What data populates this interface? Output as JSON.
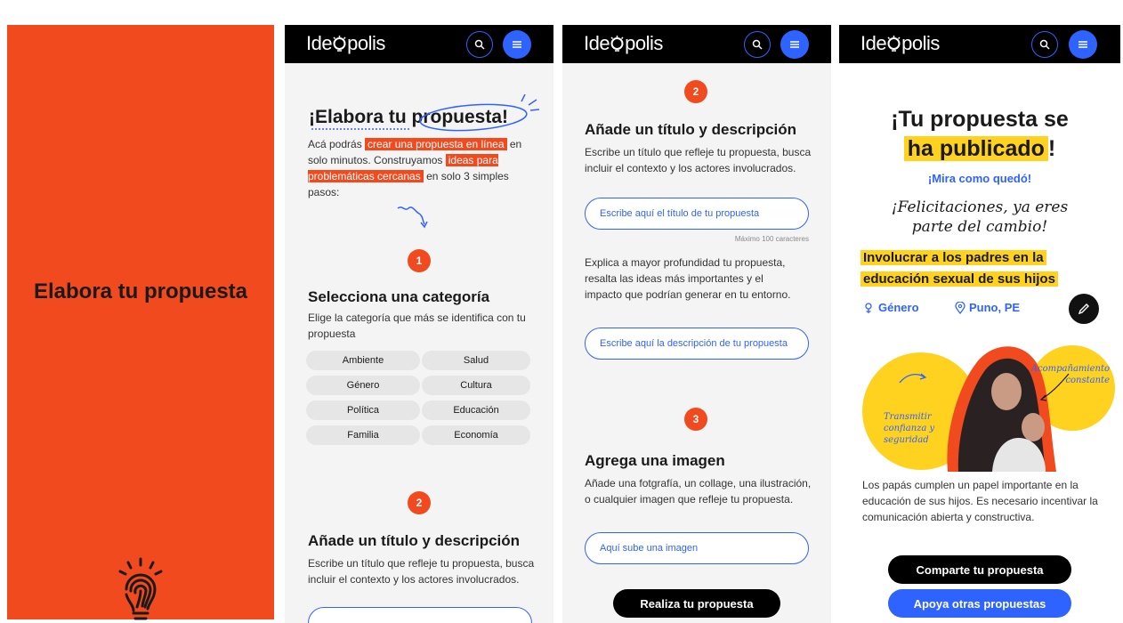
{
  "cover": {
    "title": "Elabora tu propuesta"
  },
  "app": {
    "logo": "Ide polis"
  },
  "screen1": {
    "title": "¡Elabora tu propuesta!",
    "intro": {
      "t1": "Acá podrás ",
      "h1": "crear una propuesta en línea",
      "t2": " en solo minutos. Construyamos ",
      "h2": "ideas para problemáticas cercanas",
      "t3": " en solo 3 simples pasos:"
    },
    "step1": {
      "number": "1",
      "title": "Selecciona una categoría",
      "desc": "Elige la categoría que más se identifica con tu propuesta"
    },
    "categories": [
      "Ambiente",
      "Salud",
      "Género",
      "Cultura",
      "Política",
      "Educación",
      "Familia",
      "Economía"
    ],
    "step2": {
      "number": "2",
      "title": "Añade un título y descripción",
      "desc": "Escribe un título que refleje tu propuesta, busca incluir el contexto y los actores involucrados."
    }
  },
  "screen2": {
    "step2": {
      "number": "2",
      "title": "Añade un título y descripción",
      "desc": "Escribe un título que refleje tu propuesta, busca incluir el contexto y los actores involucrados."
    },
    "title_input": {
      "placeholder": "Escribe aquí el título de tu propuesta",
      "hint": "Máximo 100 caracteres"
    },
    "desc_text": "Explica a mayor profundidad tu propuesta, resalta las ideas más importantes y el impacto que podrían generar en tu entorno.",
    "desc_input": {
      "placeholder": "Escribe aquí la descripción de tu propuesta"
    },
    "step3": {
      "number": "3",
      "title": "Agrega una imagen",
      "desc": "Añade una fotgrafía, un collage, una ilustración, o cualquier imagen que refleje tu propuesta."
    },
    "image_input": {
      "placeholder": "Aquí sube una imagen"
    },
    "submit_label": "Realiza tu propuesta"
  },
  "screen3": {
    "title_a": "¡Tu propuesta se",
    "title_b": "ha publicado",
    "title_c": "!",
    "link": "¡Mira como quedó!",
    "congrats_1": "¡Felicitaciones, ya eres",
    "congrats_2": "parte del cambio!",
    "proposal_title_1": "Involucrar a los padres en la",
    "proposal_title_2": "educación sexual de sus hijos",
    "tag_category": "Género",
    "tag_location": "Puno, PE",
    "note_top_1": "Acompañamiento",
    "note_top_2": "constante",
    "note_left_1": "Transmitir",
    "note_left_2": "confianza y",
    "note_left_3": "seguridad",
    "description": "Los papás cumplen un papel importante en la educación de sus hijos. Es necesario incentivar la comunicación abierta y constructiva.",
    "share_label": "Comparte tu propuesta",
    "support_label": "Apoya otras propuestas"
  },
  "colors": {
    "accent_orange": "#f24a1f",
    "accent_blue": "#2f63ff",
    "accent_yellow": "#ffd21f",
    "bar": "#000000"
  }
}
